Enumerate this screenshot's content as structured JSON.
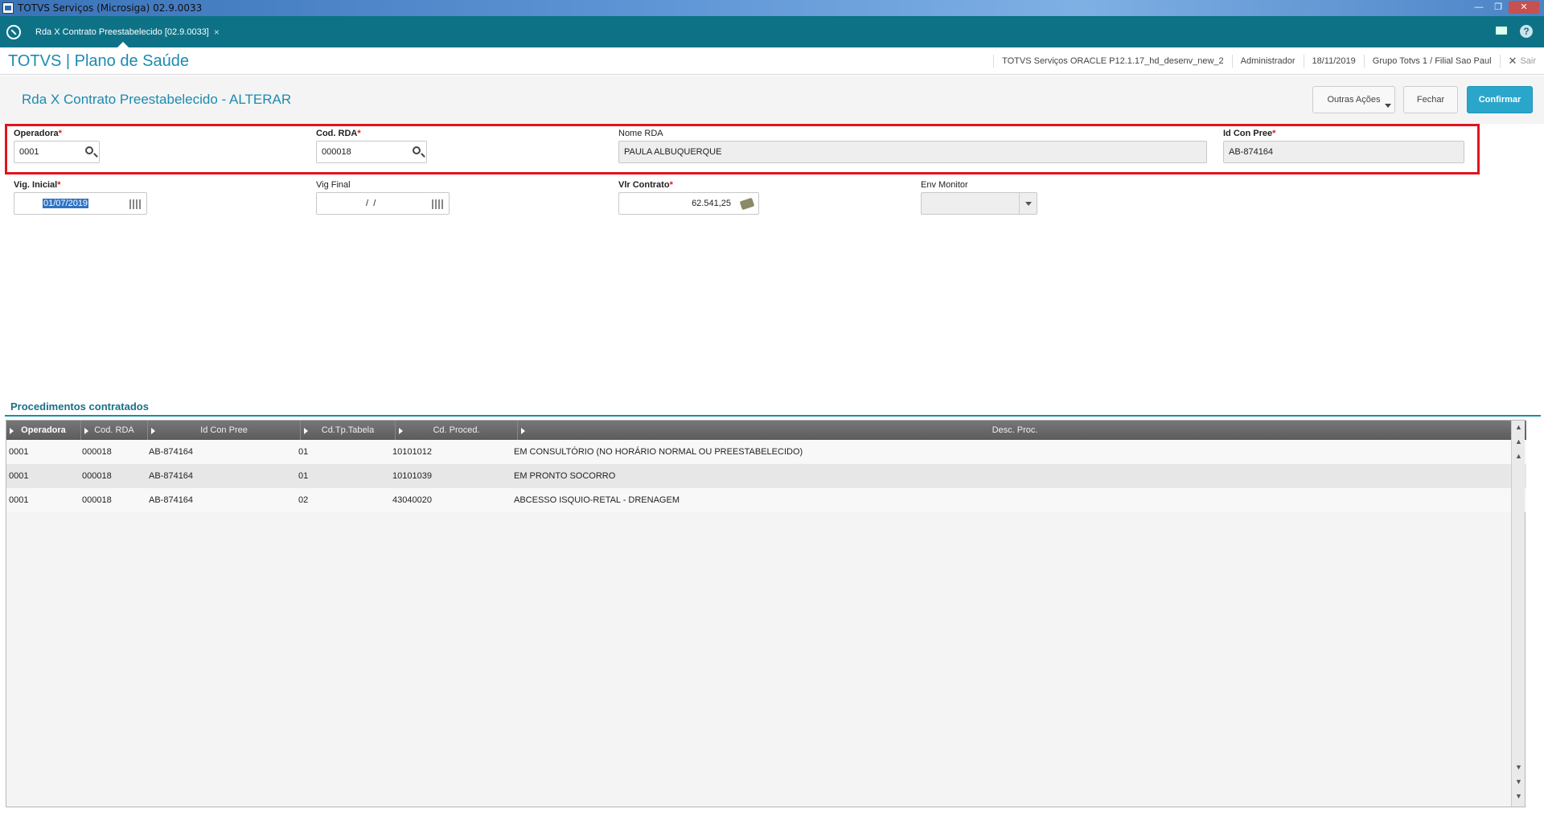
{
  "window": {
    "title": "TOTVS Serviços (Microsiga) 02.9.0033"
  },
  "tabbar": {
    "tab_label": "Rda X Contrato Preestabelecido [02.9.0033]",
    "tab_close": "×",
    "help": "?"
  },
  "header": {
    "brand": "TOTVS | Plano de Saúde",
    "environment": "TOTVS Serviços ORACLE P12.1.17_hd_desenv_new_2",
    "user": "Administrador",
    "date": "18/11/2019",
    "company": "Grupo Totvs 1 / Filial Sao Paul",
    "logout": "Sair"
  },
  "page": {
    "title": "Rda X Contrato Preestabelecido - ALTERAR",
    "buttons": {
      "other_actions": "Outras Ações",
      "close": "Fechar",
      "confirm": "Confirmar"
    }
  },
  "form": {
    "operadora": {
      "label": "Operadora",
      "value": "0001",
      "required": "*"
    },
    "cod_rda": {
      "label": "Cod. RDA",
      "value": "000018",
      "required": "*"
    },
    "nome_rda": {
      "label": "Nome RDA",
      "value": "PAULA ALBUQUERQUE"
    },
    "id_con_pree": {
      "label": "Id Con Pree",
      "value": "AB-874164",
      "required": "*"
    },
    "vig_inicial": {
      "label": "Vig. Inicial",
      "value": "01/07/2019",
      "required": "*"
    },
    "vig_final": {
      "label": "Vig Final",
      "value": " /  / "
    },
    "vlr_contrato": {
      "label": "Vlr Contrato",
      "value": "62.541,25",
      "required": "*"
    },
    "env_monitor": {
      "label": "Env Monitor",
      "value": ""
    }
  },
  "grid": {
    "title": "Procedimentos contratados",
    "columns": [
      "Operadora",
      "Cod. RDA",
      "Id Con Pree",
      "Cd.Tp.Tabela",
      "Cd. Proced.",
      "Desc. Proc."
    ],
    "rows": [
      [
        "0001",
        "000018",
        "AB-874164",
        "01",
        "10101012",
        "EM CONSULTÓRIO (NO HORÁRIO NORMAL OU PREESTABELECIDO)"
      ],
      [
        "0001",
        "000018",
        "AB-874164",
        "01",
        "10101039",
        "EM PRONTO SOCORRO"
      ],
      [
        "0001",
        "000018",
        "AB-874164",
        "02",
        "43040020",
        "ABCESSO ISQUIO-RETAL - DRENAGEM"
      ]
    ]
  },
  "colors": {
    "teal": "#0e7287",
    "brand_blue": "#1b8bb0",
    "confirm": "#2ba6cb",
    "highlight": "#e0141e"
  }
}
